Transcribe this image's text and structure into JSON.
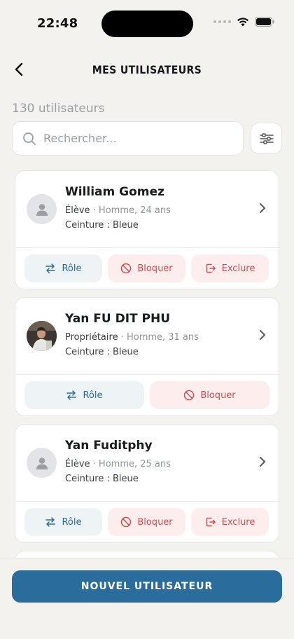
{
  "status_bar": {
    "time": "22:48"
  },
  "header": {
    "title": "MES UTILISATEURS"
  },
  "summary": {
    "count_label": "130 utilisateurs"
  },
  "search": {
    "placeholder": "Rechercher...",
    "value": ""
  },
  "users": [
    {
      "name": "William Gomez",
      "role": "Élève",
      "details": "· Homme, 24 ans",
      "belt": "Ceinture : Bleue",
      "has_photo": false,
      "actions": {
        "role": "Rôle",
        "block": "Bloquer",
        "exclude": "Exclure"
      }
    },
    {
      "name": "Yan FU DIT PHU",
      "role": "Propriétaire",
      "details": "· Homme, 31 ans",
      "belt": "Ceinture : Bleue",
      "has_photo": true,
      "actions": {
        "role": "Rôle",
        "block": "Bloquer"
      }
    },
    {
      "name": "Yan Fuditphy",
      "role": "Élève",
      "details": "· Homme, 25 ans",
      "belt": "Ceinture : Bleue",
      "has_photo": false,
      "actions": {
        "role": "Rôle",
        "block": "Bloquer",
        "exclude": "Exclure"
      }
    }
  ],
  "footer": {
    "new_user_label": "NOUVEL UTILISATEUR"
  },
  "icons": {
    "back": "chevron-left-icon",
    "search": "search-icon",
    "filter": "sliders-icon",
    "role": "swap-arrows-icon",
    "block": "block-icon",
    "exclude": "logout-icon",
    "chevron": "chevron-right-icon",
    "avatar": "user-silhouette-icon"
  },
  "colors": {
    "background": "#F3F2EF",
    "primary": "#2A6D9C",
    "danger": "#D94B4B",
    "role_bg": "#EEF3F6",
    "danger_bg": "#FDEDED"
  }
}
